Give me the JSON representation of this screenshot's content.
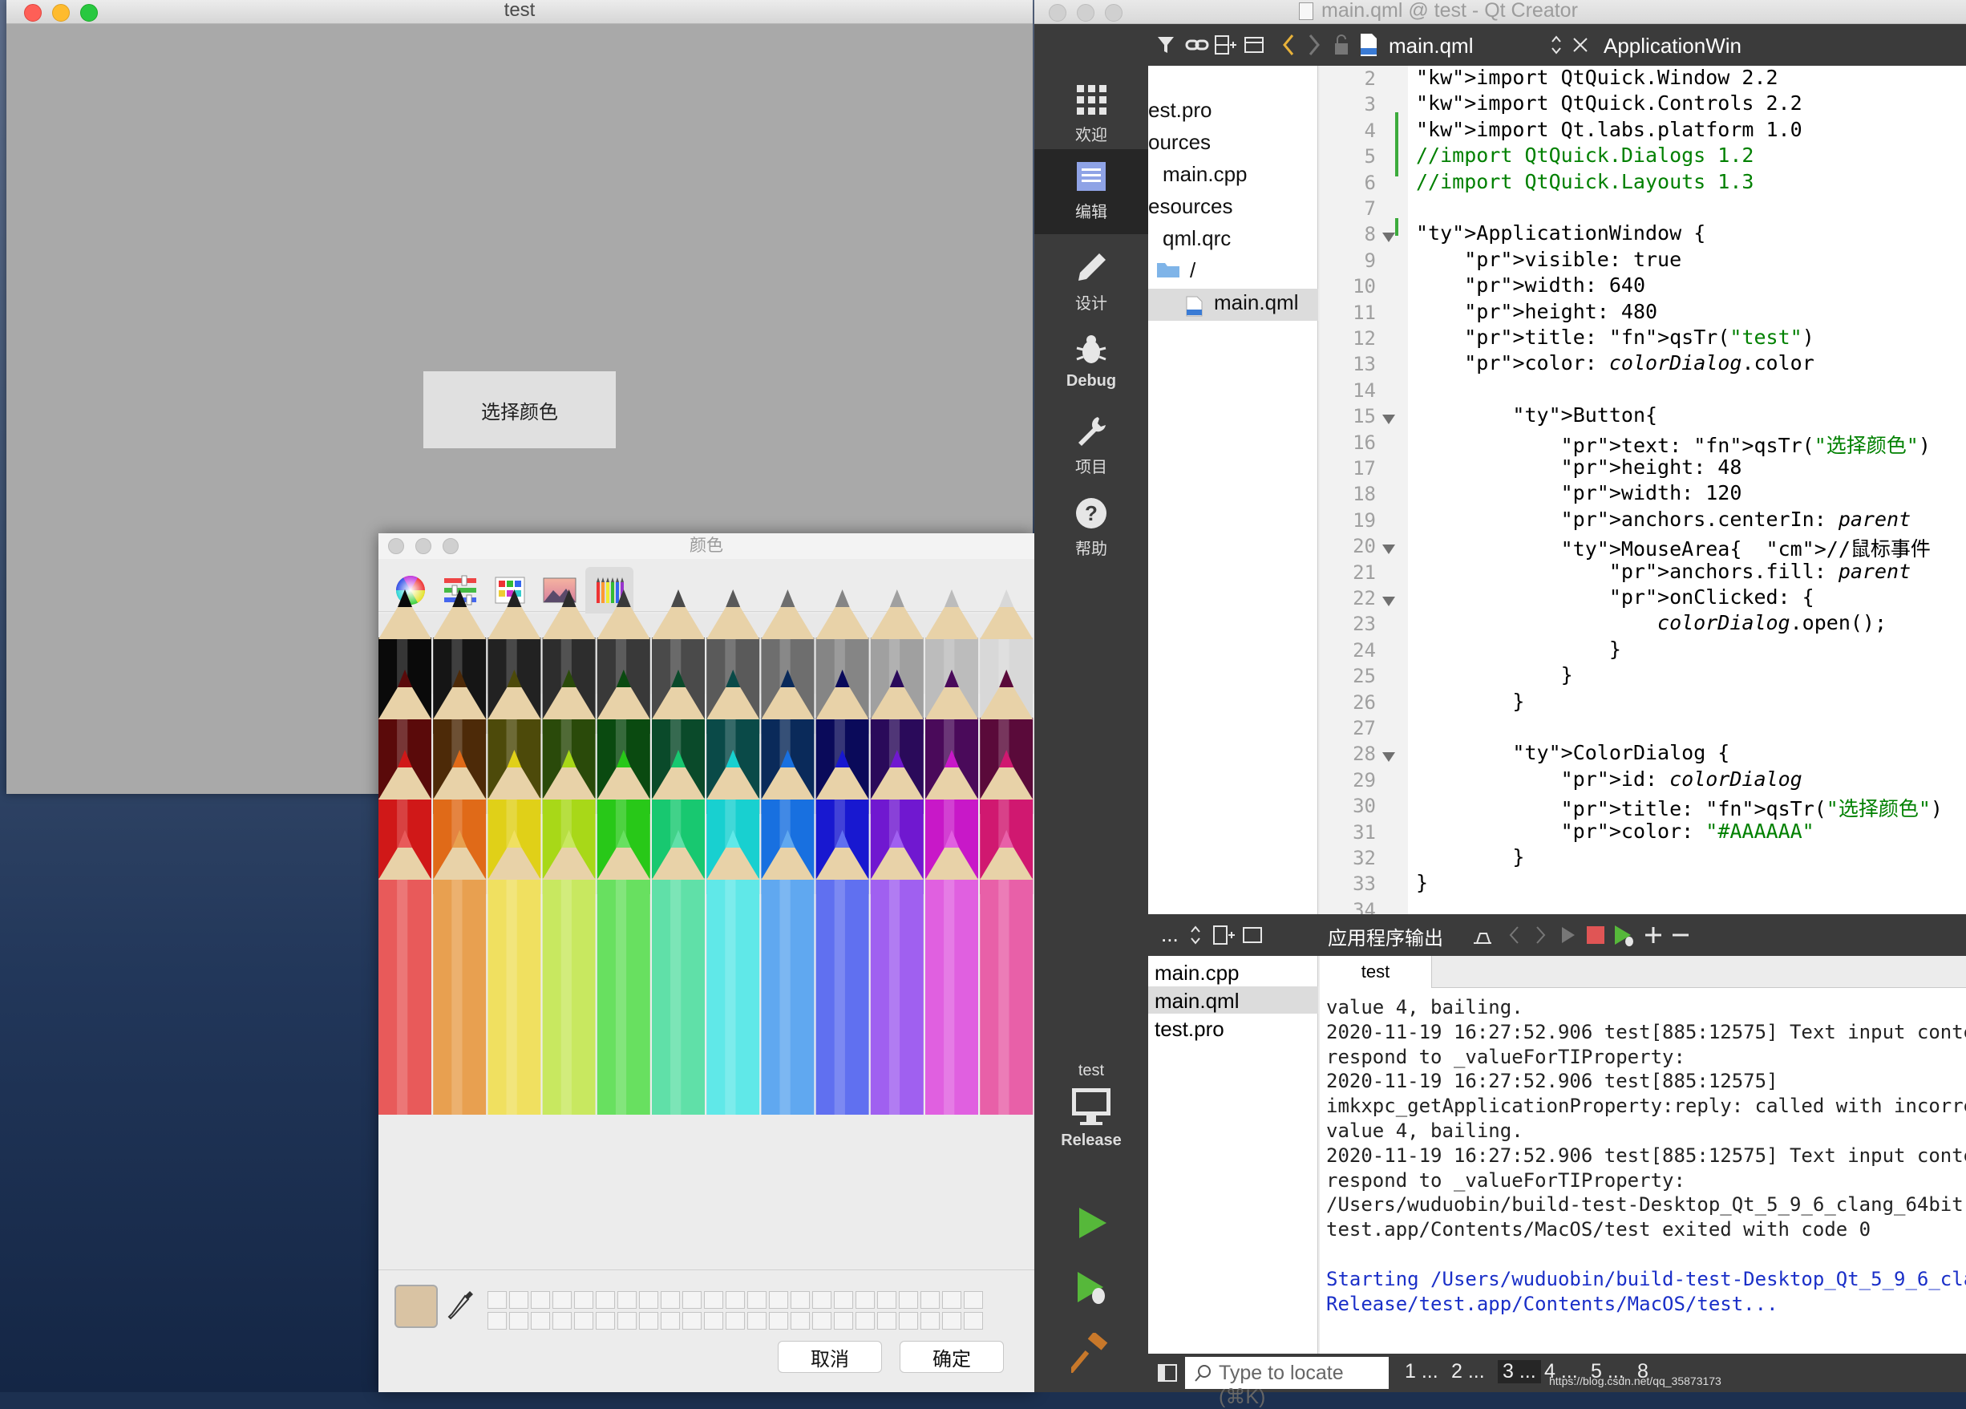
{
  "test_window": {
    "title": "test",
    "button_label": "选择颜色"
  },
  "color_panel": {
    "title": "颜色",
    "tabs": [
      "color-wheel",
      "sliders",
      "palettes",
      "image-palettes",
      "pencils"
    ],
    "current_color": "#d9c3a3",
    "cancel": "取消",
    "ok": "确定"
  },
  "qt": {
    "window_title": "main.qml @ test - Qt Creator",
    "modes": [
      "欢迎",
      "编辑",
      "设计",
      "Debug",
      "项目",
      "帮助"
    ],
    "kit_name": "test",
    "kit_config": "Release",
    "open_file": "main.qml",
    "class_crumb": "ApplicationWin",
    "tree": [
      "est.pro",
      "ources",
      "main.cpp",
      "esources",
      "qml.qrc",
      "/",
      "main.qml"
    ],
    "open_docs_combo": "...",
    "open_docs": [
      "main.cpp",
      "main.qml",
      "test.pro"
    ],
    "output_title": "应用程序输出",
    "output_tab": "test",
    "locate_placeholder": "Type to locate (⌘K)",
    "status_tabs": [
      "1 ...",
      "2 ...",
      "3 ...",
      "4 ...",
      "5 ...",
      "8"
    ],
    "watermark": "https://blog.csdn.net/qq_35873173"
  },
  "code_lines": [
    "2",
    "import QtQuick.Window 2.2",
    "3",
    "import QtQuick.Controls 2.2",
    "4",
    "import Qt.labs.platform 1.0",
    "5",
    "//import QtQuick.Dialogs 1.2",
    "6",
    "//import QtQuick.Layouts 1.3",
    "7",
    "",
    "8",
    "ApplicationWindow {",
    "9",
    "    visible: true",
    "10",
    "    width: 640",
    "11",
    "    height: 480",
    "12",
    "    title: qsTr(\"test\")",
    "13",
    "    color: colorDialog.color",
    "14",
    "",
    "15",
    "        Button{",
    "16",
    "            text: qsTr(\"选择颜色\")",
    "17",
    "            height: 48",
    "18",
    "            width: 120",
    "19",
    "            anchors.centerIn: parent",
    "20",
    "            MouseArea{  //鼠标事件",
    "21",
    "                anchors.fill: parent",
    "22",
    "                onClicked: {",
    "23",
    "                    colorDialog.open();",
    "24",
    "                }",
    "25",
    "            }",
    "26",
    "        }",
    "27",
    "",
    "28",
    "        ColorDialog {",
    "29",
    "            id: colorDialog",
    "30",
    "            title: qsTr(\"选择颜色\")",
    "31",
    "            color: \"#AAAAAA\"",
    "32",
    "        }",
    "33",
    "}",
    "34",
    ""
  ],
  "output_lines": [
    "value 4, bailing.",
    "2020-11-19 16:27:52.906 test[885:12575] Text input conte",
    "respond to _valueForTIProperty:",
    "2020-11-19 16:27:52.906 test[885:12575]",
    "imkxpc_getApplicationProperty:reply: called with incorre",
    "value 4, bailing.",
    "2020-11-19 16:27:52.906 test[885:12575] Text input conte",
    "respond to _valueForTIProperty:",
    "/Users/wuduobin/build-test-Desktop_Qt_5_9_6_clang_64bit-",
    "test.app/Contents/MacOS/test exited with code 0",
    "",
    "Starting /Users/wuduobin/build-test-Desktop_Qt_5_9_6_cla",
    "Release/test.app/Contents/MacOS/test..."
  ]
}
